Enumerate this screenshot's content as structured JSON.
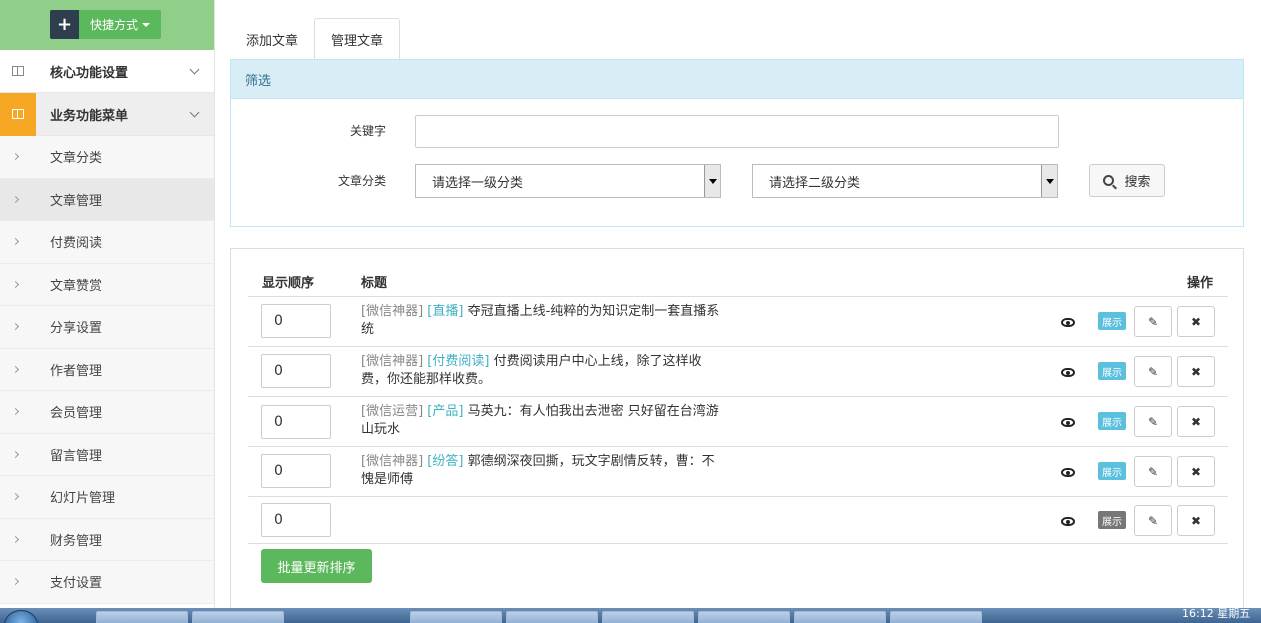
{
  "sidebar": {
    "quick_label": "快捷方式",
    "groups": [
      {
        "label": "核心功能设置"
      },
      {
        "label": "业务功能菜单"
      }
    ],
    "items": [
      {
        "label": "文章分类"
      },
      {
        "label": "文章管理"
      },
      {
        "label": "付费阅读"
      },
      {
        "label": "文章赞赏"
      },
      {
        "label": "分享设置"
      },
      {
        "label": "作者管理"
      },
      {
        "label": "会员管理"
      },
      {
        "label": "留言管理"
      },
      {
        "label": "幻灯片管理"
      },
      {
        "label": "财务管理"
      },
      {
        "label": "支付设置"
      }
    ]
  },
  "tabs": [
    {
      "label": "添加文章"
    },
    {
      "label": "管理文章"
    }
  ],
  "filter": {
    "heading": "筛选",
    "keyword_label": "关键字",
    "keyword_value": "",
    "category_label": "文章分类",
    "category1": "请选择一级分类",
    "category2": "请选择二级分类",
    "search_label": "搜索"
  },
  "table": {
    "headers": {
      "order": "显示顺序",
      "title": "标题",
      "action": "操作"
    },
    "rows": [
      {
        "order": "0",
        "source": "[微信神器]",
        "category": "[直播]",
        "title": "夺冠直播上线-纯粹的为知识定制一套直播系统",
        "badge": "展示"
      },
      {
        "order": "0",
        "source": "[微信神器]",
        "category": "[付费阅读]",
        "title": "付费阅读用户中心上线，除了这样收费，你还能那样收费。",
        "badge": "展示"
      },
      {
        "order": "0",
        "source": "[微信运营]",
        "category": "[产品]",
        "title": "马英九：有人怕我出去泄密 只好留在台湾游山玩水",
        "badge": "展示"
      },
      {
        "order": "0",
        "source": "[微信神器]",
        "category": "[纷答]",
        "title": "郭德纲深夜回撕，玩文字剧情反转，曹：不愧是师傅",
        "badge": "展示"
      },
      {
        "order": "0",
        "source": "",
        "category": "",
        "title": "",
        "badge": "展示"
      }
    ],
    "batch_label": "批量更新排序"
  },
  "taskbar": {
    "clock": "16:12 星期五"
  },
  "colors": {
    "sidebar_top": "#8fcf8a",
    "active_group": "#f5a623",
    "primary_green": "#5cb85c",
    "info_blue": "#5bc0de",
    "panel_header": "#d9edf7"
  }
}
